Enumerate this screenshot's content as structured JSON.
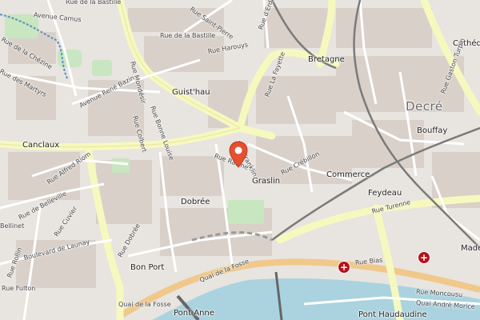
{
  "map": {
    "center_marker": "location-pin-icon",
    "marker_color": "#e5502f",
    "water_color": "#aad3df",
    "road_color": "#f6f9be",
    "districts": [
      "Decré"
    ],
    "places": [
      "Bretagne",
      "Guist'hau",
      "Canclaux",
      "Graslin",
      "Commerce",
      "Feydeau",
      "Bouffay",
      "Dobrée",
      "Bon Port",
      "Cathédr",
      "Made",
      "Pont Anne",
      "Pont Haudaudine"
    ],
    "streets": [
      "Avenue Camus",
      "Rue de la Bastille",
      "Rue de la Bastille",
      "Rue Saint-Pierre",
      "Rue de la Chézine",
      "Rue d'Erdre",
      "Rue Harouys",
      "Rue des Martyrs",
      "Rue Mondésir",
      "Avenue René Bazin",
      "Rue Bonne Louise",
      "Rue Colbert",
      "Rue La Fayette",
      "Rue Franklin",
      "Rue Racine",
      "Rue Crébillon",
      "Rue Alfred Riom",
      "Rue de Belleville",
      "Rue Cuvier",
      "Boulevard de Launay",
      "Rue Dobrée",
      "Rue Rollin",
      "Rue Fulton",
      "Quai de la Fosse",
      "Quai de la Fosse",
      "Rue Bias",
      "Rue Turenne",
      "Rue Moncousu",
      "Quai André Morice",
      "Bellinet",
      "Rue Gaston Turpin"
    ],
    "poi_icons": [
      "hospital-icon",
      "hospital-icon"
    ]
  }
}
